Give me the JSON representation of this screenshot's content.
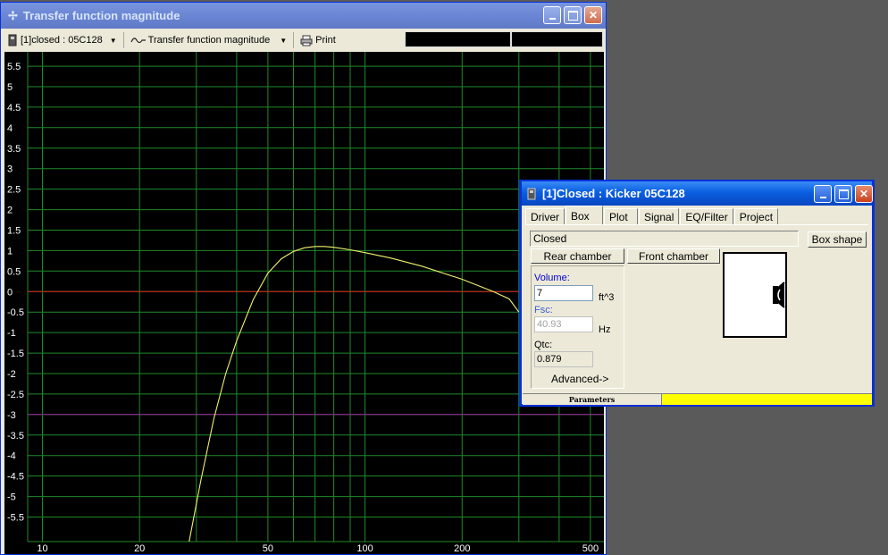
{
  "main_window": {
    "title": "Transfer function magnitude",
    "toolbar": {
      "driver_select": "[1]closed : 05C128",
      "plot_select": "Transfer function magnitude",
      "print_label": "Print"
    }
  },
  "chart_data": {
    "type": "line",
    "xscale": "log",
    "xlim": [
      9,
      540
    ],
    "ylim": [
      -6.1,
      5.85
    ],
    "x_ticks": [
      10,
      20,
      50,
      100,
      200,
      500
    ],
    "x_tick_labels": [
      "10",
      "20",
      "50",
      "100",
      "200",
      "500"
    ],
    "x_grid": [
      10,
      20,
      30,
      40,
      50,
      60,
      70,
      80,
      90,
      100,
      200,
      300,
      400,
      500
    ],
    "y_ticks": [
      5.5,
      5,
      4.5,
      4,
      3.5,
      3,
      2.5,
      2,
      1.5,
      1,
      0.5,
      0,
      -0.5,
      -1,
      -1.5,
      -2,
      -2.5,
      -3,
      -3.5,
      -4,
      -4.5,
      -5,
      -5.5
    ],
    "y_tick_labels": [
      "5.5",
      "5",
      "4.5",
      "4",
      "3.5",
      "3",
      "2.5",
      "2",
      "1.5",
      "1",
      "0.5",
      "0",
      "-0.5",
      "-1",
      "-1.5",
      "-2",
      "-2.5",
      "-3",
      "-3.5",
      "-4",
      "-4.5",
      "-5",
      "-5.5"
    ],
    "reference_lines": [
      {
        "y": 0,
        "color": "#e02020"
      },
      {
        "y": -3,
        "color": "#a020a0"
      }
    ],
    "grid": true,
    "grid_color": "#1f8a2a",
    "series": [
      {
        "color": "#f0f070",
        "x": [
          28.5,
          31,
          34,
          37,
          40,
          45,
          50,
          55,
          60,
          65,
          70,
          75,
          80,
          90,
          100,
          120,
          150,
          200,
          250,
          280,
          300
        ],
        "y": [
          -6.1,
          -4.6,
          -3.1,
          -2.0,
          -1.2,
          -0.2,
          0.45,
          0.8,
          0.98,
          1.07,
          1.1,
          1.1,
          1.08,
          1.02,
          0.95,
          0.82,
          0.62,
          0.3,
          0.0,
          -0.18,
          -0.5
        ]
      }
    ]
  },
  "box_window": {
    "title": "[1]Closed : Kicker 05C128",
    "tabs": [
      "Driver",
      "Box",
      "Plot",
      "Signal",
      "EQ/Filter",
      "Project"
    ],
    "active_tab": "Box",
    "box_type": "Closed",
    "box_shape_button": "Box shape",
    "rear_chamber_button": "Rear chamber",
    "front_chamber_button": "Front chamber",
    "volume_label": "Volume:",
    "volume_value": "7",
    "volume_unit": "ft^3",
    "fsc_label": "Fsc:",
    "fsc_value": "40.93",
    "fsc_unit": "Hz",
    "qtc_label": "Qtc:",
    "qtc_value": "0.879",
    "advanced_button": "Advanced->",
    "status_text": "Parameters",
    "status_color": "#ffff00"
  }
}
